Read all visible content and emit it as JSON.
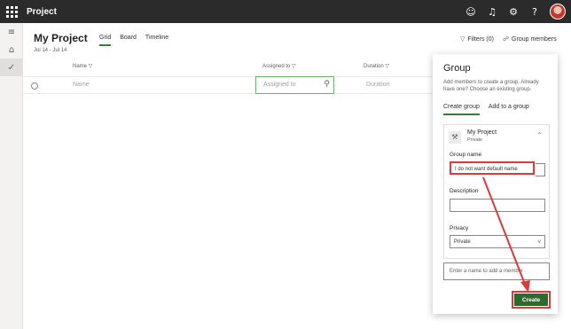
{
  "app": {
    "title": "Project"
  },
  "topbar": {
    "icons": [
      "smiley-icon",
      "bell-icon",
      "gear-icon",
      "help-icon"
    ],
    "glyphs": {
      "smiley": "☺",
      "bell": "♫",
      "gear": "⚙",
      "help": "?"
    }
  },
  "leftrail": {
    "items": [
      "hamburger-icon",
      "home-icon",
      "check-icon"
    ],
    "glyphs": {
      "menu": "≡",
      "home": "⌂",
      "check": "✓"
    }
  },
  "project": {
    "title": "My Project",
    "dates": "Jul 14 - Jul 14"
  },
  "views": {
    "tabs": [
      {
        "label": "Grid",
        "active": true
      },
      {
        "label": "Board"
      },
      {
        "label": "Timeline"
      }
    ]
  },
  "actions": {
    "filters": "Filters (0)",
    "group_members": "Group members",
    "filter_glyph": "▽",
    "members_glyph": "☍"
  },
  "grid": {
    "columns": {
      "name": "Name ▽",
      "assigned": "Assigned to ▽",
      "duration": "Duration ▽"
    },
    "new_row": {
      "name_placeholder": "Name",
      "assigned_placeholder": "Assigned to",
      "duration_placeholder": "Duration",
      "assign_glyph": "⚲"
    }
  },
  "panel": {
    "title": "Group",
    "description": "Add members to create a group. Already have one? Choose an existing group.",
    "tabs": {
      "create": "Create group",
      "add": "Add to a group"
    },
    "card": {
      "group_name": "My Project",
      "privacy_value": "Private",
      "group_glyph": "⚒",
      "chevron_up": "^",
      "group_name_label": "Group name",
      "group_name_value": "I do not want default name",
      "description_label": "Description",
      "description_value": "",
      "privacy_label": "Privacy",
      "privacy_selected": "Private",
      "chevron_down": "v"
    },
    "member_placeholder": "Enter a name to add a member",
    "create_label": "Create"
  },
  "colors": {
    "accent": "#3a7d3a",
    "highlight": "#d93a3a",
    "topbar": "#2b2b2b",
    "create": "#2d6a2d"
  }
}
